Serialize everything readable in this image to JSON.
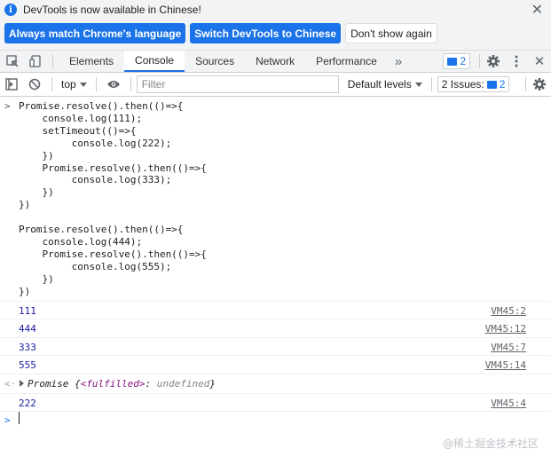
{
  "infobar": {
    "message": "DevTools is now available in Chinese!",
    "btn_match": "Always match Chrome's language",
    "btn_switch": "Switch DevTools to Chinese",
    "btn_dont_show": "Don't show again",
    "close": "✕"
  },
  "tabs": {
    "items": [
      "Elements",
      "Console",
      "Sources",
      "Network",
      "Performance"
    ],
    "active": "Console",
    "more": "»",
    "issues_count": "2"
  },
  "console_toolbar": {
    "context": "top",
    "filter_placeholder": "Filter",
    "levels": "Default levels",
    "issues_label": "2 Issues:",
    "issues_count": "2"
  },
  "code": "Promise.resolve().then(()=>{\n    console.log(111);\n    setTimeout(()=>{\n         console.log(222);\n    })\n    Promise.resolve().then(()=>{\n         console.log(333);\n    })\n})\n\nPromise.resolve().then(()=>{\n    console.log(444);\n    Promise.resolve().then(()=>{\n         console.log(555);\n    })\n})",
  "logs": [
    {
      "value": "111",
      "source": "VM45:2"
    },
    {
      "value": "444",
      "source": "VM45:12"
    },
    {
      "value": "333",
      "source": "VM45:7"
    },
    {
      "value": "555",
      "source": "VM45:14"
    }
  ],
  "promise_result": {
    "prefix": "Promise {",
    "key": "<fulfilled>",
    "sep": ": ",
    "val": "undefined",
    "suffix": "}"
  },
  "late_log": {
    "value": "222",
    "source": "VM45:4"
  },
  "watermark": "@稀土掘金技术社区"
}
